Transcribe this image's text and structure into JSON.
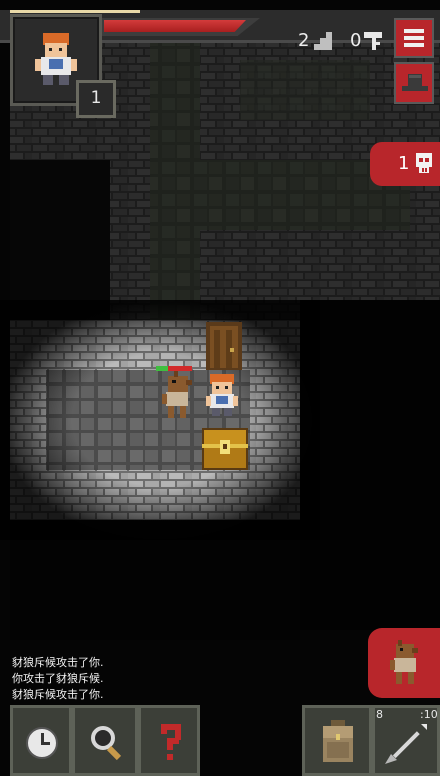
{
  "status": {
    "hero_level": "1",
    "depth": "2",
    "keys": "0",
    "danger_count": "1",
    "hp_fraction": 0.9
  },
  "log": [
    "豺狼斥候攻击了你.",
    "你攻击了豺狼斥候.",
    "豺狼斥候攻击了你."
  ],
  "toolbar": {
    "quickslot_left_count": "8",
    "quickslot_right_count": ":10"
  },
  "icons": {
    "wait": "clock-icon",
    "search": "magnifier-icon",
    "info": "question-mark-icon",
    "inventory": "backpack-icon",
    "quickslot": "dart-icon",
    "menu": "hamburger-icon",
    "journal": "hat-icon",
    "danger": "skull-icon",
    "depth": "stairs-icon",
    "keys": "key-icon"
  },
  "colors": {
    "accent_red": "#b8262b",
    "hp_red": "#d33b3b",
    "stone": "#8a8a8a"
  }
}
